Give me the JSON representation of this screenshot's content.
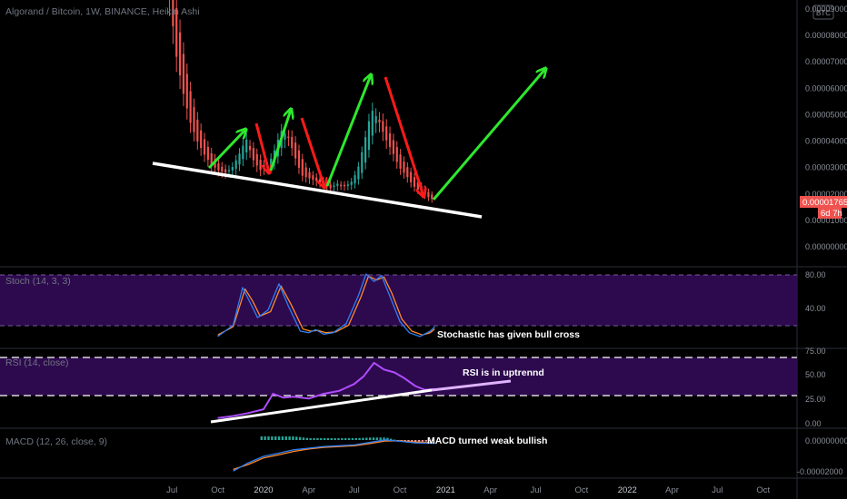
{
  "header": {
    "title": "Algorand / Bitcoin, 1W, BINANCE, Heikin Ashi",
    "currency_badge": "BTC"
  },
  "colors": {
    "background": "#000000",
    "candle_up": "#26a69a",
    "candle_down": "#ef5350",
    "arrow_up": "#2ee82e",
    "arrow_down": "#ff1a1a",
    "trendline": "#ffffff",
    "band_fill": "#2d0a4e",
    "stoch_k": "#2f7ff5",
    "stoch_d": "#ff8a2b",
    "rsi_line": "#b04cff",
    "rsi_trend_ext": "#e0b3ff",
    "macd_line": "#2f7ff5",
    "signal_line": "#ff8a2b",
    "price_tag": "#ef5350"
  },
  "price_axis": {
    "ticks": [
      "0.00009000",
      "0.00008000",
      "0.00007000",
      "0.00006000",
      "0.00005000",
      "0.00004000",
      "0.00003000",
      "0.00002000",
      "0.00001000",
      "0.00000000"
    ],
    "last_price": "0.00001765",
    "countdown": "6d 7h"
  },
  "time_axis": {
    "ticks": [
      "Jul",
      "Oct",
      "2020",
      "Apr",
      "Jul",
      "Oct",
      "2021",
      "Apr",
      "Jul",
      "Oct",
      "2022",
      "Apr",
      "Jul",
      "Oct"
    ]
  },
  "indicators": {
    "stoch": {
      "label": "Stoch (14, 3, 3)",
      "ticks": [
        "80.00",
        "40.00"
      ],
      "annotation": "Stochastic has given bull cross"
    },
    "rsi": {
      "label": "RSI (14, close)",
      "ticks": [
        "75.00",
        "50.00",
        "25.00",
        "0.00"
      ],
      "annotation": "RSI is in uptrennd"
    },
    "macd": {
      "label": "MACD (12, 26, close, 9)",
      "ticks": [
        "0.00000000",
        "-0.00002000"
      ],
      "annotation": "MACD turned weak bullish"
    }
  },
  "chart_data": [
    {
      "type": "candlestick",
      "title": "Algorand / Bitcoin, 1W, BINANCE, Heikin Ashi",
      "y_unit": "BTC",
      "ylim": [
        0,
        9.5e-05
      ],
      "x_range": [
        "2019-07",
        "2022-12"
      ],
      "last_value": 1.765e-05,
      "close_path": [
        [
          "2019-06-24",
          9.5e-05
        ],
        [
          "2019-07-08",
          7.2e-05
        ],
        [
          "2019-07-22",
          5.8e-05
        ],
        [
          "2019-08-05",
          4.7e-05
        ],
        [
          "2019-08-19",
          4e-05
        ],
        [
          "2019-09-02",
          3.5e-05
        ],
        [
          "2019-09-16",
          3.1e-05
        ],
        [
          "2019-09-30",
          2.9e-05
        ],
        [
          "2019-10-14",
          2.8e-05
        ],
        [
          "2019-10-28",
          3e-05
        ],
        [
          "2019-11-11",
          3.5e-05
        ],
        [
          "2019-11-25",
          4.1e-05
        ],
        [
          "2019-12-09",
          3.3e-05
        ],
        [
          "2019-12-23",
          2.9e-05
        ],
        [
          "2020-01-06",
          3e-05
        ],
        [
          "2020-01-20",
          3.6e-05
        ],
        [
          "2020-02-03",
          4.4e-05
        ],
        [
          "2020-02-17",
          4.2e-05
        ],
        [
          "2020-03-02",
          3.4e-05
        ],
        [
          "2020-03-16",
          2.7e-05
        ],
        [
          "2020-03-30",
          2.6e-05
        ],
        [
          "2020-04-13",
          2.5e-05
        ],
        [
          "2020-04-27",
          2.4e-05
        ],
        [
          "2020-05-11",
          2.2e-05
        ],
        [
          "2020-05-25",
          2.4e-05
        ],
        [
          "2020-06-08",
          2.3e-05
        ],
        [
          "2020-06-22",
          2.4e-05
        ],
        [
          "2020-07-06",
          2.9e-05
        ],
        [
          "2020-07-20",
          4e-05
        ],
        [
          "2020-08-03",
          5.2e-05
        ],
        [
          "2020-08-17",
          4.8e-05
        ],
        [
          "2020-08-31",
          4.1e-05
        ],
        [
          "2020-09-14",
          3.6e-05
        ],
        [
          "2020-09-28",
          3e-05
        ],
        [
          "2020-10-12",
          2.7e-05
        ],
        [
          "2020-10-26",
          2.3e-05
        ],
        [
          "2020-11-09",
          2.1e-05
        ],
        [
          "2020-11-23",
          1.9e-05
        ],
        [
          "2020-12-07",
          1.765e-05
        ]
      ]
    },
    {
      "type": "line",
      "title": "Stoch (14, 3, 3)",
      "ylim": [
        0,
        100
      ],
      "series": [
        {
          "name": "%K",
          "values": [
            [
              "2019-10-01",
              5
            ],
            [
              "2019-11-01",
              20
            ],
            [
              "2019-11-20",
              70
            ],
            [
              "2019-12-05",
              50
            ],
            [
              "2019-12-20",
              30
            ],
            [
              "2020-01-10",
              40
            ],
            [
              "2020-02-01",
              75
            ],
            [
              "2020-02-20",
              45
            ],
            [
              "2020-03-15",
              12
            ],
            [
              "2020-04-01",
              10
            ],
            [
              "2020-04-15",
              14
            ],
            [
              "2020-05-01",
              8
            ],
            [
              "2020-05-20",
              10
            ],
            [
              "2020-06-15",
              22
            ],
            [
              "2020-07-10",
              60
            ],
            [
              "2020-07-25",
              88
            ],
            [
              "2020-08-10",
              78
            ],
            [
              "2020-08-25",
              86
            ],
            [
              "2020-09-10",
              60
            ],
            [
              "2020-10-01",
              25
            ],
            [
              "2020-10-20",
              10
            ],
            [
              "2020-11-10",
              5
            ],
            [
              "2020-12-01",
              12
            ],
            [
              "2020-12-10",
              18
            ]
          ]
        },
        {
          "name": "%D",
          "values": [
            [
              "2019-10-01",
              7
            ],
            [
              "2019-11-01",
              18
            ],
            [
              "2019-11-25",
              68
            ],
            [
              "2019-12-10",
              52
            ],
            [
              "2019-12-25",
              32
            ],
            [
              "2020-01-15",
              38
            ],
            [
              "2020-02-05",
              72
            ],
            [
              "2020-02-25",
              48
            ],
            [
              "2020-03-20",
              15
            ],
            [
              "2020-04-05",
              12
            ],
            [
              "2020-04-20",
              13
            ],
            [
              "2020-05-05",
              10
            ],
            [
              "2020-05-25",
              11
            ],
            [
              "2020-06-20",
              20
            ],
            [
              "2020-07-15",
              58
            ],
            [
              "2020-07-30",
              85
            ],
            [
              "2020-08-15",
              80
            ],
            [
              "2020-08-30",
              84
            ],
            [
              "2020-09-15",
              62
            ],
            [
              "2020-10-05",
              28
            ],
            [
              "2020-10-25",
              12
            ],
            [
              "2020-11-15",
              7
            ],
            [
              "2020-12-01",
              10
            ],
            [
              "2020-12-10",
              15
            ]
          ]
        }
      ]
    },
    {
      "type": "line",
      "title": "RSI (14, close)",
      "ylim": [
        0,
        75
      ],
      "series": [
        {
          "name": "RSI",
          "values": [
            [
              "2019-10-01",
              5
            ],
            [
              "2019-11-01",
              7
            ],
            [
              "2019-12-01",
              10
            ],
            [
              "2020-01-01",
              14
            ],
            [
              "2020-01-20",
              30
            ],
            [
              "2020-02-10",
              26
            ],
            [
              "2020-03-01",
              27
            ],
            [
              "2020-04-01",
              25
            ],
            [
              "2020-05-01",
              30
            ],
            [
              "2020-06-01",
              33
            ],
            [
              "2020-07-01",
              40
            ],
            [
              "2020-07-20",
              48
            ],
            [
              "2020-08-10",
              62
            ],
            [
              "2020-08-30",
              55
            ],
            [
              "2020-09-20",
              52
            ],
            [
              "2020-10-10",
              46
            ],
            [
              "2020-11-01",
              38
            ],
            [
              "2020-11-20",
              34
            ],
            [
              "2020-12-10",
              35
            ]
          ]
        }
      ]
    },
    {
      "type": "bar",
      "title": "MACD (12, 26, close, 9)",
      "ylim": [
        -2e-05,
        3e-06
      ],
      "series": [
        {
          "name": "MACD",
          "values": [
            [
              "2019-11-01",
              -1.9e-05
            ],
            [
              "2019-12-01",
              -1.4e-05
            ],
            [
              "2020-01-01",
              -1e-05
            ],
            [
              "2020-02-01",
              -8e-06
            ],
            [
              "2020-03-01",
              -6e-06
            ],
            [
              "2020-04-01",
              -5e-06
            ],
            [
              "2020-05-01",
              -4e-06
            ],
            [
              "2020-06-01",
              -3.5e-06
            ],
            [
              "2020-07-01",
              -3e-06
            ],
            [
              "2020-08-01",
              -1.5e-06
            ],
            [
              "2020-09-01",
              1e-07
            ],
            [
              "2020-10-01",
              -8e-07
            ],
            [
              "2020-11-01",
              -1.8e-06
            ],
            [
              "2020-12-10",
              -2e-06
            ]
          ]
        },
        {
          "name": "Signal",
          "values": [
            [
              "2019-11-01",
              -1.8e-05
            ],
            [
              "2019-12-01",
              -1.5e-05
            ],
            [
              "2020-01-01",
              -1.1e-05
            ],
            [
              "2020-02-01",
              -9e-06
            ],
            [
              "2020-03-01",
              -7e-06
            ],
            [
              "2020-04-01",
              -5.5e-06
            ],
            [
              "2020-05-01",
              -4.5e-06
            ],
            [
              "2020-06-01",
              -4e-06
            ],
            [
              "2020-07-01",
              -3.5e-06
            ],
            [
              "2020-08-01",
              -2.2e-06
            ],
            [
              "2020-09-01",
              -6e-07
            ],
            [
              "2020-10-01",
              -5e-07
            ],
            [
              "2020-11-01",
              -1.2e-06
            ],
            [
              "2020-12-10",
              -1.8e-06
            ]
          ]
        }
      ]
    }
  ]
}
